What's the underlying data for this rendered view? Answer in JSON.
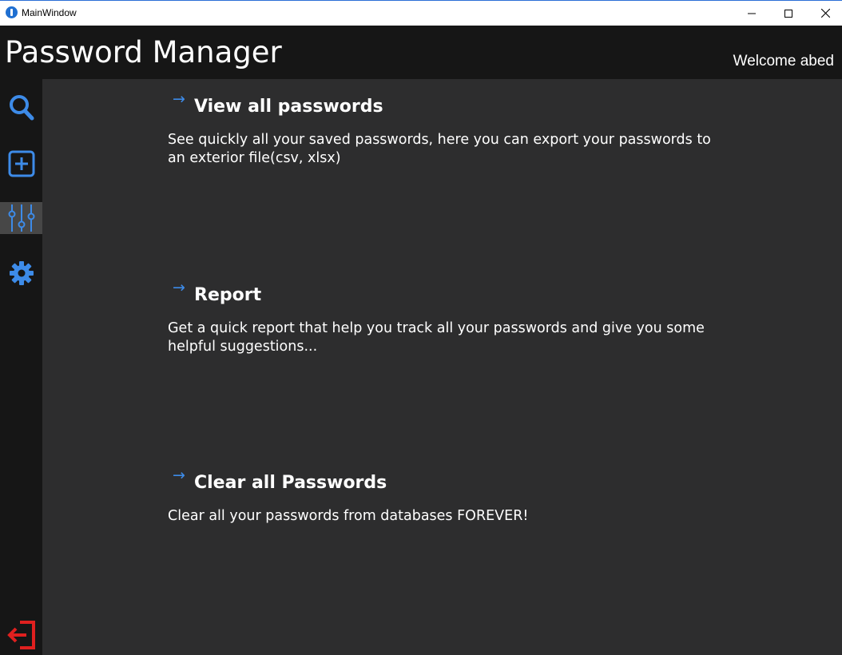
{
  "window": {
    "title": "MainWindow",
    "controls": [
      "minimize-icon",
      "maximize-icon",
      "close-icon"
    ]
  },
  "header": {
    "app_title": "Password Manager",
    "welcome": "Welcome abed"
  },
  "sidebar": {
    "items": [
      {
        "name": "search",
        "icon": "search-icon",
        "active": false
      },
      {
        "name": "add",
        "icon": "add-square-icon",
        "active": false
      },
      {
        "name": "tools",
        "icon": "sliders-icon",
        "active": true
      },
      {
        "name": "settings",
        "icon": "gear-icon",
        "active": false
      }
    ],
    "logout_icon": "logout-icon"
  },
  "sections": [
    {
      "arrow": "→",
      "title": "View all passwords",
      "description": "See quickly all your saved passwords, here you can export your passwords to an exterior file(csv, xlsx)"
    },
    {
      "arrow": "→",
      "title": "Report",
      "description": "Get a quick report that help you track all your passwords and give you some helpful suggestions..."
    },
    {
      "arrow": "→",
      "title": "Clear all Passwords",
      "description": "Clear all your passwords from databases FOREVER!"
    }
  ],
  "colors": {
    "accent": "#3d8be8",
    "logout": "#e0201f",
    "background": "#2d2d2e",
    "sidebar": "#161616",
    "active_item": "#474747"
  }
}
